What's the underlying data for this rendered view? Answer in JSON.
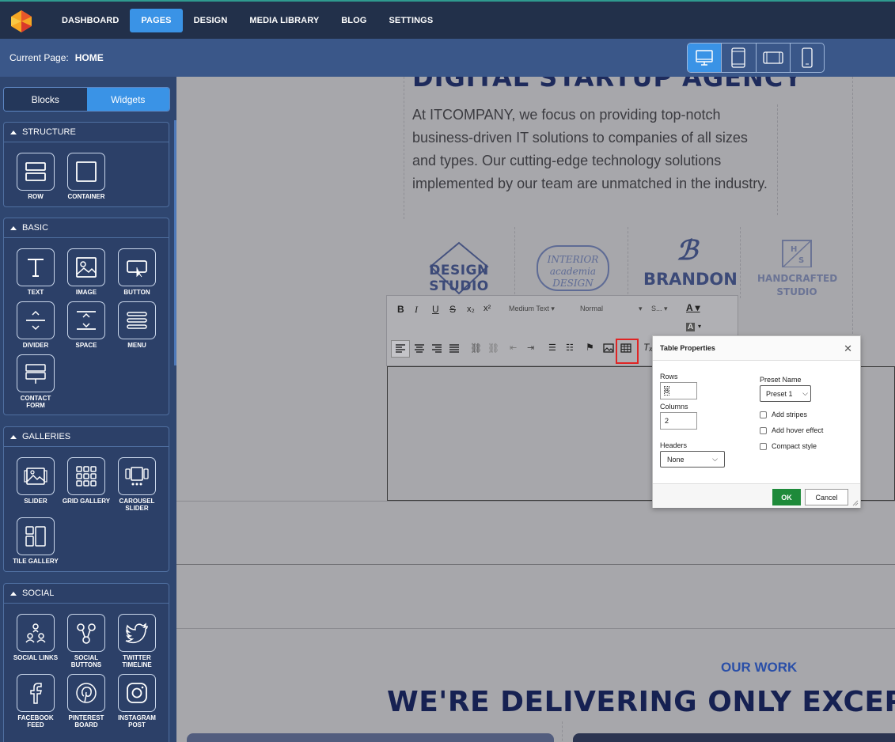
{
  "nav": {
    "items": [
      {
        "label": "DASHBOARD",
        "active": false
      },
      {
        "label": "PAGES",
        "active": true
      },
      {
        "label": "DESIGN",
        "active": false
      },
      {
        "label": "MEDIA LIBRARY",
        "active": false
      },
      {
        "label": "BLOG",
        "active": false
      },
      {
        "label": "SETTINGS",
        "active": false
      }
    ]
  },
  "subbar": {
    "current_label": "Current Page:",
    "current_value": "HOME"
  },
  "devices": [
    "desktop-icon",
    "tablet-icon",
    "tablet-landscape-icon",
    "mobile-icon"
  ],
  "sidebar": {
    "tabs": [
      {
        "label": "Blocks",
        "active": false
      },
      {
        "label": "Widgets",
        "active": true
      }
    ],
    "sections": [
      {
        "title": "STRUCTURE",
        "widgets": [
          "ROW",
          "CONTAINER"
        ]
      },
      {
        "title": "BASIC",
        "widgets": [
          "TEXT",
          "IMAGE",
          "BUTTON",
          "DIVIDER",
          "SPACE",
          "MENU",
          "CONTACT FORM"
        ]
      },
      {
        "title": "GALLERIES",
        "widgets": [
          "SLIDER",
          "GRID GALLERY",
          "CAROUSEL SLIDER",
          "TILE GALLERY"
        ]
      },
      {
        "title": "SOCIAL",
        "widgets": [
          "SOCIAL LINKS",
          "SOCIAL BUTTONS",
          "TWITTER TIMELINE",
          "FACEBOOK FEED",
          "PINTEREST BOARD",
          "INSTAGRAM POST"
        ]
      }
    ]
  },
  "canvas": {
    "hero_title": "DIGITAL STARTUP AGENCY",
    "paragraph": "At ITCOMPANY, we focus on providing top-notch business-driven IT solutions to companies of all sizes and types. Our cutting-edge technology solutions implemented by our team are unmatched in the industry.",
    "logos": [
      "DESIGN STUDIO",
      "INTERIOR academia DESIGN",
      "BRANDON",
      "HANDCRAFTED STUDIO"
    ],
    "toolbar": {
      "format_1": "Medium Text",
      "format_2": "Normal",
      "format_3": "S..."
    },
    "our_work": "OUR WORK",
    "big_title": "WE'RE DELIVERING ONLY EXCEPTIONA"
  },
  "dialog": {
    "title": "Table Properties",
    "rows_label": "Rows",
    "rows_value": "8",
    "columns_label": "Columns",
    "columns_value": "2",
    "headers_label": "Headers",
    "headers_value": "None",
    "preset_label": "Preset Name",
    "preset_value": "Preset 1",
    "checkboxes": [
      "Add stripes",
      "Add hover effect",
      "Compact style"
    ],
    "ok": "OK",
    "cancel": "Cancel"
  }
}
